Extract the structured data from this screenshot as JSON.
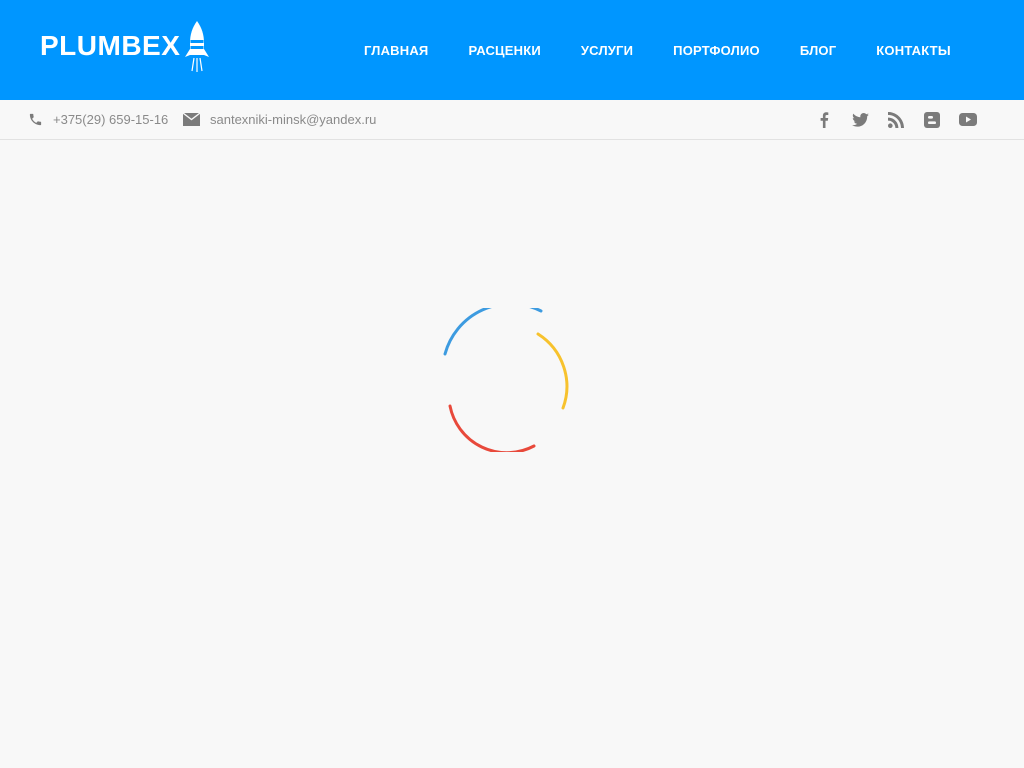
{
  "header": {
    "logo_text": "PLUMBEX",
    "logo_icon": "rocket-icon",
    "nav": [
      {
        "label": "ГЛАВНАЯ"
      },
      {
        "label": "РАСЦЕНКИ"
      },
      {
        "label": "УСЛУГИ"
      },
      {
        "label": "ПОРТФОЛИО"
      },
      {
        "label": "БЛОГ"
      },
      {
        "label": "КОНТАКТЫ"
      }
    ]
  },
  "topbar": {
    "phone": "+375(29) 659-15-16",
    "email": "santexniki-minsk@yandex.ru",
    "social": [
      "facebook-icon",
      "twitter-icon",
      "rss-icon",
      "blogger-icon",
      "youtube-icon"
    ]
  },
  "loader": {
    "icon": "loading-spinner",
    "colors": [
      "#3d9be0",
      "#f7c22d",
      "#e8493b"
    ]
  },
  "colors": {
    "header_bg": "#0096ff",
    "page_bg": "#f8f8f8",
    "topbar_text": "#8a8a8a",
    "icon_gray": "#7b7b7b"
  }
}
